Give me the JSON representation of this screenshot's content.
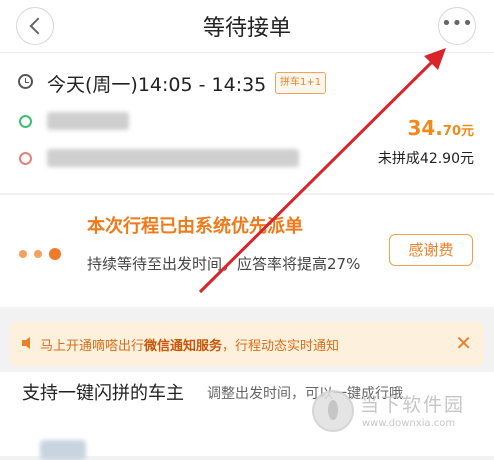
{
  "header": {
    "title": "等待接单",
    "more_icon": "•••"
  },
  "trip": {
    "time": "今天(周一)14:05 - 14:35",
    "carpool_badge": "拼车1+1",
    "price_int": "34.",
    "price_dec": "70元",
    "price_note": "未拼成42.90元"
  },
  "status": {
    "title": "本次行程已由系统优先派单",
    "desc": "持续等待至出发时间，应答率将提高27%",
    "thanks_label": "感谢费"
  },
  "notice": {
    "text_pre": "马上开通嘀嗒出行",
    "text_bold": "微信通知服务",
    "text_post": "，行程动态实时通知",
    "close_label": "✕"
  },
  "promo": {
    "title": "支持一键闪拼的车主",
    "desc": "调整出发时间，可以一键成行哦"
  },
  "watermark": {
    "text": "当下软件园",
    "url": "www.downxia.com"
  },
  "colors": {
    "accent": "#f07a1a",
    "arrow": "#d9242b",
    "notice_bg": "#fdf0dd"
  }
}
